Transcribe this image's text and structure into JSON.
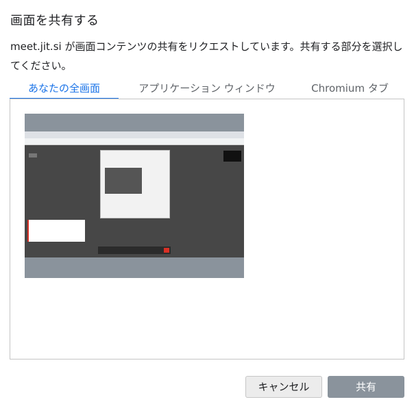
{
  "dialog": {
    "title": "画面を共有する",
    "description": "meet.jit.si が画面コンテンツの共有をリクエストしています。共有する部分を選択してください。"
  },
  "tabs": [
    {
      "label": "あなたの全画面",
      "active": true
    },
    {
      "label": "アプリケーション ウィンドウ",
      "active": false
    },
    {
      "label": "Chromium タブ",
      "active": false
    }
  ],
  "buttons": {
    "cancel": "キャンセル",
    "share": "共有"
  },
  "colors": {
    "accent": "#1a73e8",
    "share_disabled": "#8a939c"
  }
}
